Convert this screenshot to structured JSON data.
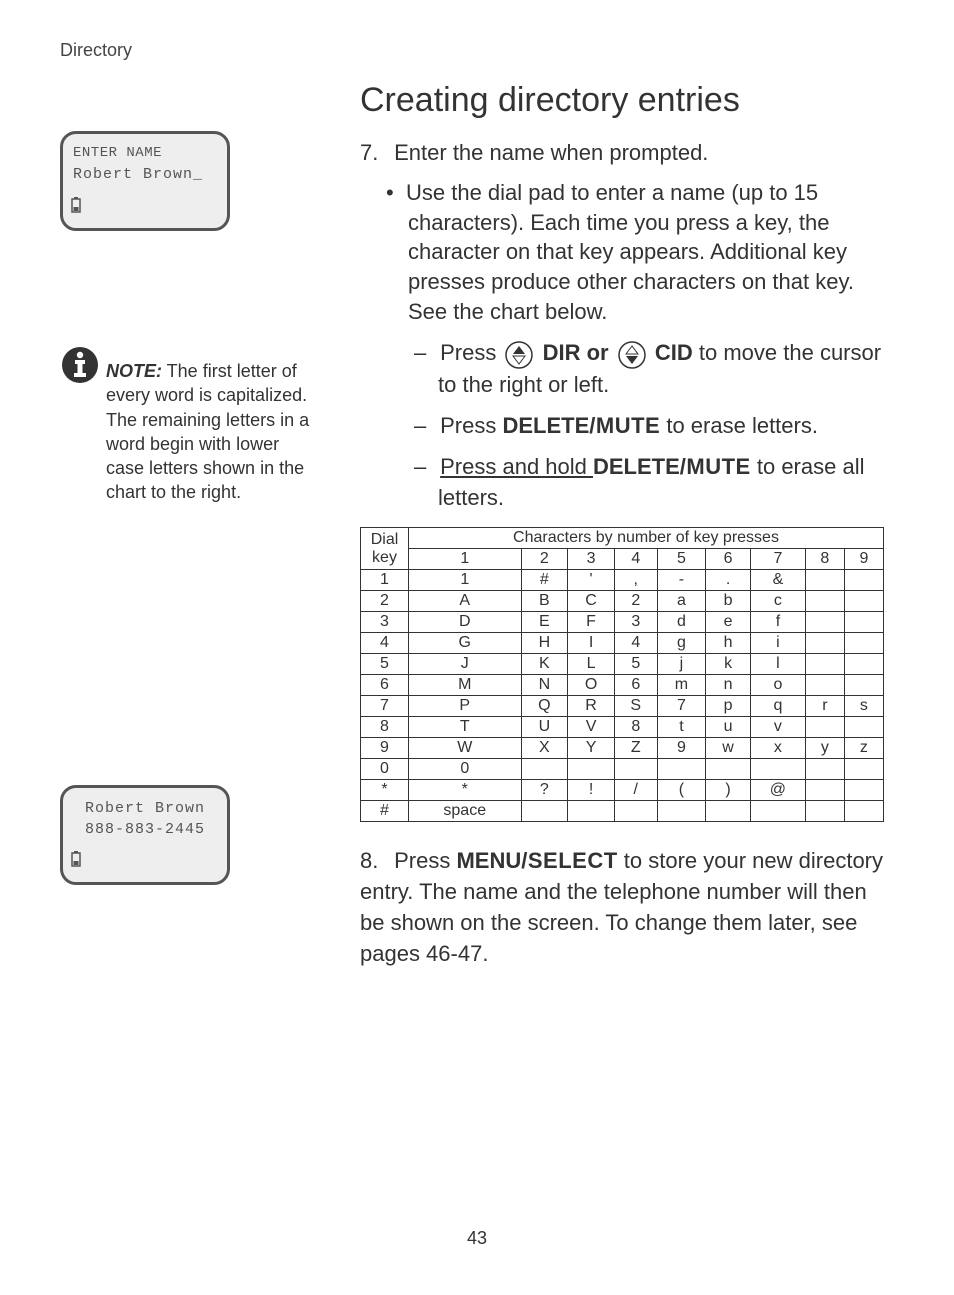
{
  "header": {
    "section": "Directory"
  },
  "title": "Creating directory entries",
  "step7": {
    "num": "7.",
    "text": "Enter the name when prompted.",
    "bullet": "Use the dial pad to enter a name (up to 15 characters). Each time you press a key, the character on that key appears. Additional key presses produce other characters on that key. See the chart below.",
    "dash1_pre": "Press ",
    "dash1_dir": "DIR or",
    "dash1_cid": "CID",
    "dash1_post": " to move the cursor to the right or left.",
    "dash2_pre": "Press ",
    "dash2_bold": "DELETE",
    "dash2_mute": "/MUTE",
    "dash2_post": " to erase letters.",
    "dash3_pre": "Press and hold ",
    "dash3_bold": "DELETE",
    "dash3_mute": "/MUTE",
    "dash3_post": " to erase  all letters."
  },
  "step8": {
    "num": "8.",
    "pre": "Press ",
    "bold": "MENU",
    "select": "/SELECT",
    "post": " to store your new directory entry. The name and the telephone number will then be shown on the screen. To change them later, see pages 46-47."
  },
  "lcd1": {
    "line1": "ENTER NAME",
    "line2": "Robert Brown_"
  },
  "lcd2": {
    "line1": "Robert Brown",
    "line2": "888-883-2445"
  },
  "note": {
    "label": "NOTE:",
    "text": " The first letter of every word is capitalized. The remaining letters in a word begin with lower case letters shown in the chart to the right."
  },
  "chart_data": {
    "type": "table",
    "title": "Characters by number of key presses",
    "col_label": "Dial key",
    "columns": [
      "1",
      "2",
      "3",
      "4",
      "5",
      "6",
      "7",
      "8",
      "9"
    ],
    "rows": [
      {
        "key": "1",
        "cells": [
          "1",
          "#",
          "'",
          ",",
          "-",
          ".",
          "&",
          "",
          ""
        ]
      },
      {
        "key": "2",
        "cells": [
          "A",
          "B",
          "C",
          "2",
          "a",
          "b",
          "c",
          "",
          ""
        ]
      },
      {
        "key": "3",
        "cells": [
          "D",
          "E",
          "F",
          "3",
          "d",
          "e",
          "f",
          "",
          ""
        ]
      },
      {
        "key": "4",
        "cells": [
          "G",
          "H",
          "I",
          "4",
          "g",
          "h",
          "i",
          "",
          ""
        ]
      },
      {
        "key": "5",
        "cells": [
          "J",
          "K",
          "L",
          "5",
          "j",
          "k",
          "l",
          "",
          ""
        ]
      },
      {
        "key": "6",
        "cells": [
          "M",
          "N",
          "O",
          "6",
          "m",
          "n",
          "o",
          "",
          ""
        ]
      },
      {
        "key": "7",
        "cells": [
          "P",
          "Q",
          "R",
          "S",
          "7",
          "p",
          "q",
          "r",
          "s"
        ]
      },
      {
        "key": "8",
        "cells": [
          "T",
          "U",
          "V",
          "8",
          "t",
          "u",
          "v",
          "",
          ""
        ]
      },
      {
        "key": "9",
        "cells": [
          "W",
          "X",
          "Y",
          "Z",
          "9",
          "w",
          "x",
          "y",
          "z"
        ]
      },
      {
        "key": "0",
        "cells": [
          "0",
          "",
          "",
          "",
          "",
          "",
          "",
          "",
          ""
        ]
      },
      {
        "key": "*",
        "cells": [
          "*",
          "?",
          "!",
          "/",
          "(",
          ")",
          "@",
          "",
          ""
        ]
      },
      {
        "key": "#",
        "cells": [
          "space",
          "",
          "",
          "",
          "",
          "",
          "",
          "",
          ""
        ]
      }
    ]
  },
  "page_number": "43"
}
